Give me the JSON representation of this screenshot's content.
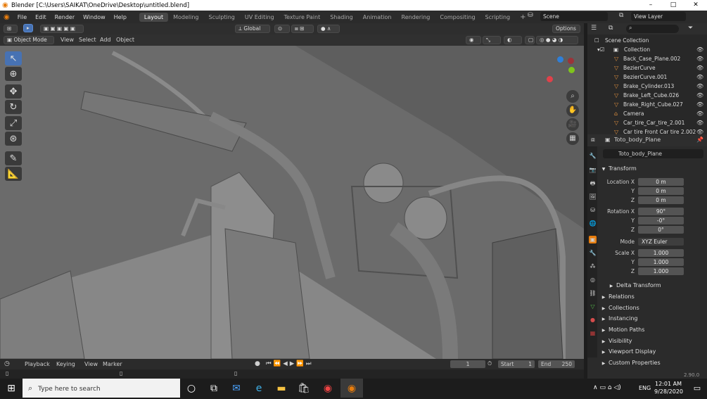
{
  "window": {
    "title": "Blender [C:\\Users\\SAIKAT\\OneDrive\\Desktop\\untitled.blend]",
    "minimize": "–",
    "maximize": "□",
    "close": "✕"
  },
  "menu": [
    "File",
    "Edit",
    "Render",
    "Window",
    "Help"
  ],
  "workspaces": [
    "Layout",
    "Modeling",
    "Sculpting",
    "UV Editing",
    "Texture Paint",
    "Shading",
    "Animation",
    "Rendering",
    "Compositing",
    "Scripting"
  ],
  "scene": {
    "name": "Scene",
    "view_layer": "View Layer"
  },
  "viewport_header": {
    "transform": "Global",
    "options": "Options",
    "mode": "Object Mode",
    "menus": [
      "View",
      "Select",
      "Add",
      "Object"
    ]
  },
  "outliner": {
    "root": "Scene Collection",
    "collection": "Collection",
    "items": [
      "Back_Case_Plane.002",
      "BezierCurve",
      "BezierCurve.001",
      "Brake_Cylinder.013",
      "Brake_Left_Cube.026",
      "Brake_Right_Cube.027",
      "Camera",
      "Car_tire_Car_tire_2.001",
      "Car tire Front Car tire 2.002"
    ]
  },
  "properties": {
    "object_name": "Toto_body_Plane",
    "header_name": "Toto_body_Plane",
    "transform_title": "Transform",
    "location_label": "Location X",
    "location": [
      "0 m",
      "0 m",
      "0 m"
    ],
    "rotation_label": "Rotation X",
    "rotation": [
      "90°",
      "-0°",
      "0°"
    ],
    "mode_label": "Mode",
    "mode": "XYZ Euler",
    "scale_label": "Scale X",
    "scale": [
      "1.000",
      "1.000",
      "1.000"
    ],
    "y": "Y",
    "z": "Z",
    "panels": [
      "Delta Transform",
      "Relations",
      "Collections",
      "Instancing",
      "Motion Paths",
      "Visibility",
      "Viewport Display",
      "Custom Properties"
    ]
  },
  "timeline": {
    "menus": [
      "Playback",
      "Keying",
      "View",
      "Marker"
    ],
    "current": "1",
    "start_label": "Start",
    "start": "1",
    "end_label": "End",
    "end": "250"
  },
  "version": "2.90.0",
  "taskbar": {
    "search": "Type here to search",
    "time": "12:01 AM",
    "date": "9/28/2020",
    "lang": "ENG"
  }
}
